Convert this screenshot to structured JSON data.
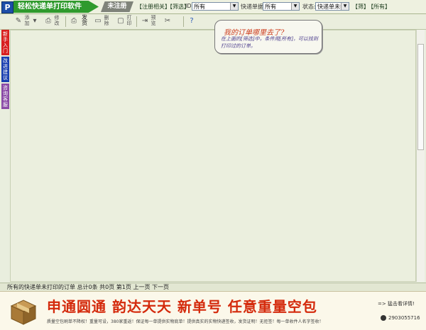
{
  "title_bar": {
    "logo_letter": "P",
    "app_title": "轻松快递单打印软件",
    "unregistered": "未注册",
    "register_link": "【注册相关】",
    "filter_link": "【筛选】",
    "id_label": "ID:",
    "id_value": "所有",
    "express_label": "快递单据:",
    "express_value": "所有",
    "state_label": "状态:",
    "state_value": "快递单未打",
    "filter_btn": "【筛】",
    "all_btn": "【所有】"
  },
  "side_tabs": [
    {
      "label": "新手入门",
      "color": "#d82020"
    },
    {
      "label": "改进建议",
      "color": "#1a3fb0"
    },
    {
      "label": "咨询客服",
      "color": "#8a4aa6"
    }
  ],
  "toolbar": {
    "send_label": "发货",
    "items_text": [
      "添加",
      "修改",
      "删除",
      "打印",
      "预览"
    ]
  },
  "note": {
    "title": "我的订单哪里去了?",
    "body": "在上面的[筛选]中，条件用[所有]，可以找到打印过的订单。"
  },
  "status_bar": {
    "text": "所有的快递单未打印的订单  总计0条 共0页 第1页    上一页 下一页"
  },
  "banner": {
    "headline": "申通圆通 韵达天天 新单号 任意重量空包",
    "subtext": "质量空包刷单不降权！重量可设，380家重返！保证每一单提供实物底单！提供真实的实物快递签收，发货证明！无拒签！每一单收件人名字签收！",
    "details_link": "=> 猛击看详情!",
    "qq": "2903055716"
  }
}
